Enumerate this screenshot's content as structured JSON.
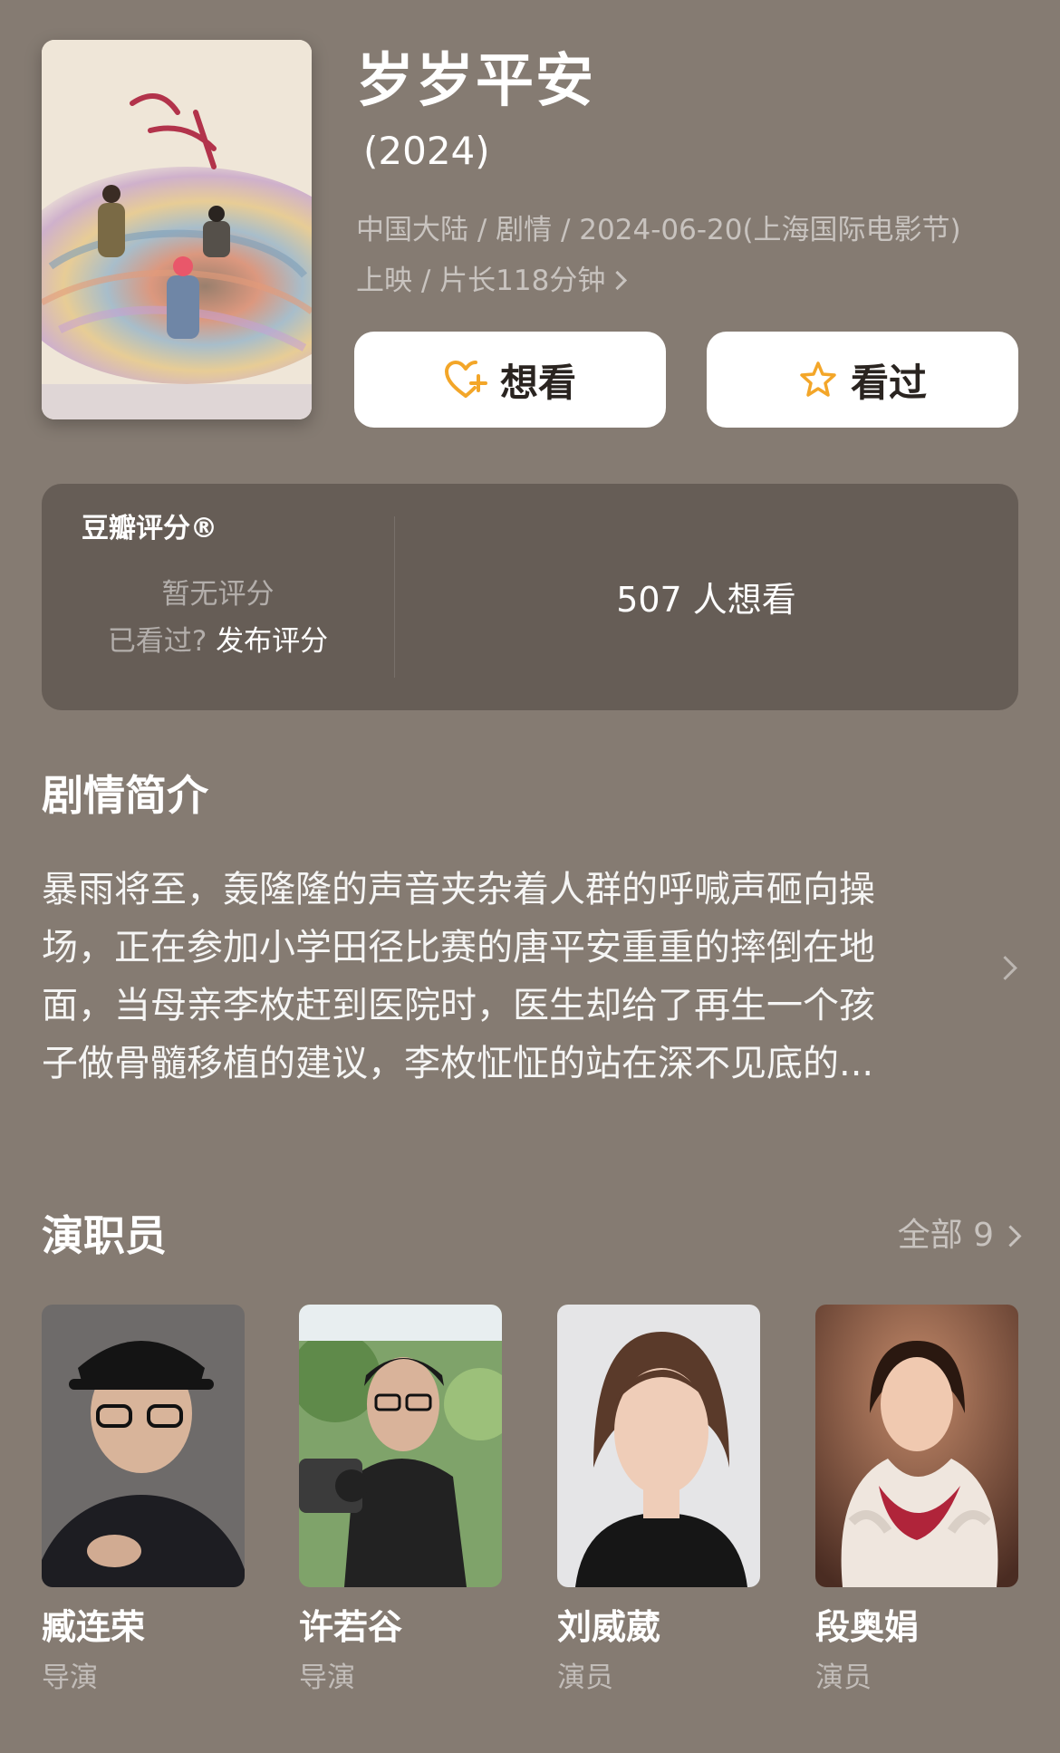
{
  "movie": {
    "title": "岁岁平安",
    "year": "(2024)",
    "meta_line1": "中国大陆 / 剧情 / 2024-06-20(上海国际电影节)",
    "meta_line2": "上映 / 片长118分钟"
  },
  "actions": {
    "want_label": "想看",
    "want_icon": "heart-plus-icon",
    "watched_label": "看过",
    "watched_icon": "star-icon",
    "icon_color": "#f3a629"
  },
  "rating": {
    "label": "豆瓣评分®",
    "no_rating": "暂无评分",
    "watched_question": "已看过?",
    "post_rating": "发布评分",
    "want_count": "507 人想看"
  },
  "synopsis": {
    "title": "剧情简介",
    "lines": [
      "暴雨将至，轰隆隆的声音夹杂着人群的呼喊声砸向操",
      "场，正在参加小学田径比赛的唐平安重重的摔倒在地",
      "面，当母亲李枚赶到医院时，医生却给了再生一个孩",
      "子做骨髓移植的建议，李枚怔怔的站在深不见底的..."
    ]
  },
  "cast": {
    "title": "演职员",
    "all_label": "全部 9",
    "members": [
      {
        "name": "臧连荣",
        "role": "导演"
      },
      {
        "name": "许若谷",
        "role": "导演"
      },
      {
        "name": "刘威葳",
        "role": "演员"
      },
      {
        "name": "段奥娟",
        "role": "演员"
      }
    ]
  },
  "colors": {
    "background": "#857b72",
    "card": "#665d56",
    "button": "#ffffff"
  }
}
